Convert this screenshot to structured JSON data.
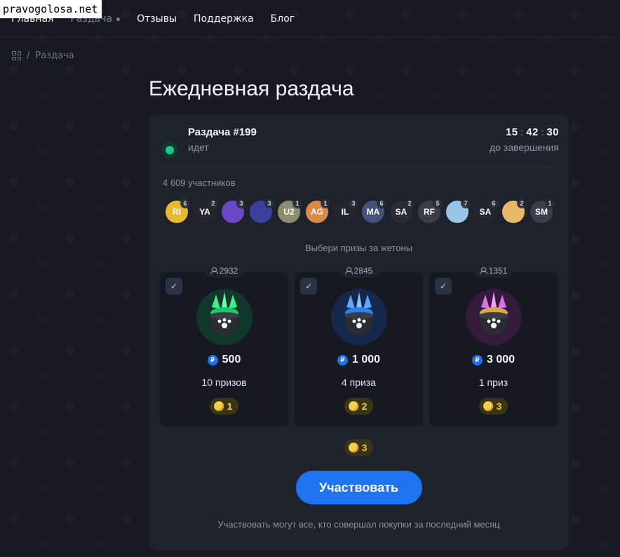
{
  "watermark": "pravogolosa.net",
  "nav": {
    "items": [
      {
        "label": "Главная",
        "active": false
      },
      {
        "label": "Раздача",
        "active": true
      },
      {
        "label": "Отзывы",
        "active": false
      },
      {
        "label": "Поддержка",
        "active": false
      },
      {
        "label": "Блог",
        "active": false
      }
    ]
  },
  "breadcrumb": {
    "icon": "grid-icon",
    "separator": "/",
    "current": "Раздача"
  },
  "page_title": "Ежедневная раздача",
  "round": {
    "title": "Раздача #199",
    "status": "идет",
    "timer": {
      "hours": "15",
      "minutes": "42",
      "seconds": "30"
    },
    "timer_label": "до завершения"
  },
  "participants_label": "4 609 участников",
  "avatars": [
    {
      "initials": "RI",
      "badge": "6",
      "color": "#e8b830"
    },
    {
      "initials": "YA",
      "badge": "2",
      "color": "#23252b"
    },
    {
      "initials": "",
      "badge": "3",
      "color": "#6a48c8"
    },
    {
      "initials": "",
      "badge": "3",
      "color": "#3b3f9e"
    },
    {
      "initials": "U2",
      "badge": "1",
      "color": "#8e8c70"
    },
    {
      "initials": "AG",
      "badge": "1",
      "color": "#d98a4a"
    },
    {
      "initials": "IL",
      "badge": "3",
      "color": "#23252b"
    },
    {
      "initials": "MA",
      "badge": "6",
      "color": "#45527a"
    },
    {
      "initials": "SA",
      "badge": "2",
      "color": "#2a2c33"
    },
    {
      "initials": "RF",
      "badge": "5",
      "color": "#3a3d47"
    },
    {
      "initials": "",
      "badge": "7",
      "color": "#9ac4e6"
    },
    {
      "initials": "SA",
      "badge": "6",
      "color": "#23252b"
    },
    {
      "initials": "",
      "badge": "2",
      "color": "#e8b86a"
    },
    {
      "initials": "SM",
      "badge": "1",
      "color": "#3a3f4c"
    }
  ],
  "pick_label": "Выбери призы за жетоны",
  "prizes": [
    {
      "participants": "2932",
      "price": "500",
      "quantity": "10 призов",
      "tokens": "1",
      "glow": "#1fc46a"
    },
    {
      "participants": "2845",
      "price": "1 000",
      "quantity": "4 приза",
      "tokens": "2",
      "glow": "#2f8af0"
    },
    {
      "participants": "1351",
      "price": "3 000",
      "quantity": "1 приз",
      "tokens": "3",
      "glow": "#c04ad8"
    }
  ],
  "total_tokens": "3",
  "join_button": "Участвовать",
  "footnote": "Участвовать могут все, кто совершал покупки за последний месяц",
  "colors": {
    "accent": "#1e74f0",
    "token_gold": "#f6c928",
    "status_green": "#20c58b"
  }
}
